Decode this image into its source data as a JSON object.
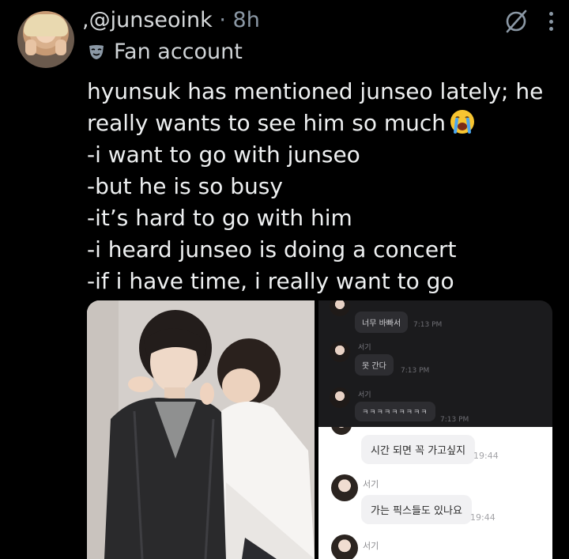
{
  "header": {
    "handle_prefix": ",",
    "handle": "@junseoink",
    "separator": " · ",
    "time_ago": "8h",
    "account_label": "Fan account"
  },
  "tweet": {
    "lines": [
      "hyunsuk has mentioned junseo lately; he",
      "really wants to see him so much",
      "-i want to go with junseo",
      "-but he is so busy",
      "-it’s hard to go with him",
      "-i heard junseo is doing a concert",
      "-if i have time, i really want to go"
    ]
  },
  "chat_dark": {
    "messages": [
      {
        "text": "너무 바빠서",
        "time": "7:13 PM"
      },
      {
        "name": "서기",
        "text": "못 간다",
        "time": "7:13 PM"
      },
      {
        "name": "서기",
        "text": "ㅋㅋㅋㅋㅋㅋㅋㅋㅋ",
        "time": "7:13 PM"
      }
    ]
  },
  "chat_light": {
    "messages": [
      {
        "text": "시간 되면 꼭 가고싶지",
        "time": "19:44"
      },
      {
        "name": "서기",
        "text": "가는 픽스들도 있나요",
        "time": "19:44"
      },
      {
        "name": "서기"
      }
    ]
  },
  "icons": {
    "grok": "grok-icon",
    "more": "more-vertical-icon",
    "label": "mask-icon",
    "emoji": "crying-face-emoji"
  },
  "colors": {
    "background": "#000000",
    "text": "#e7e9ea",
    "muted": "#8b98a5"
  }
}
